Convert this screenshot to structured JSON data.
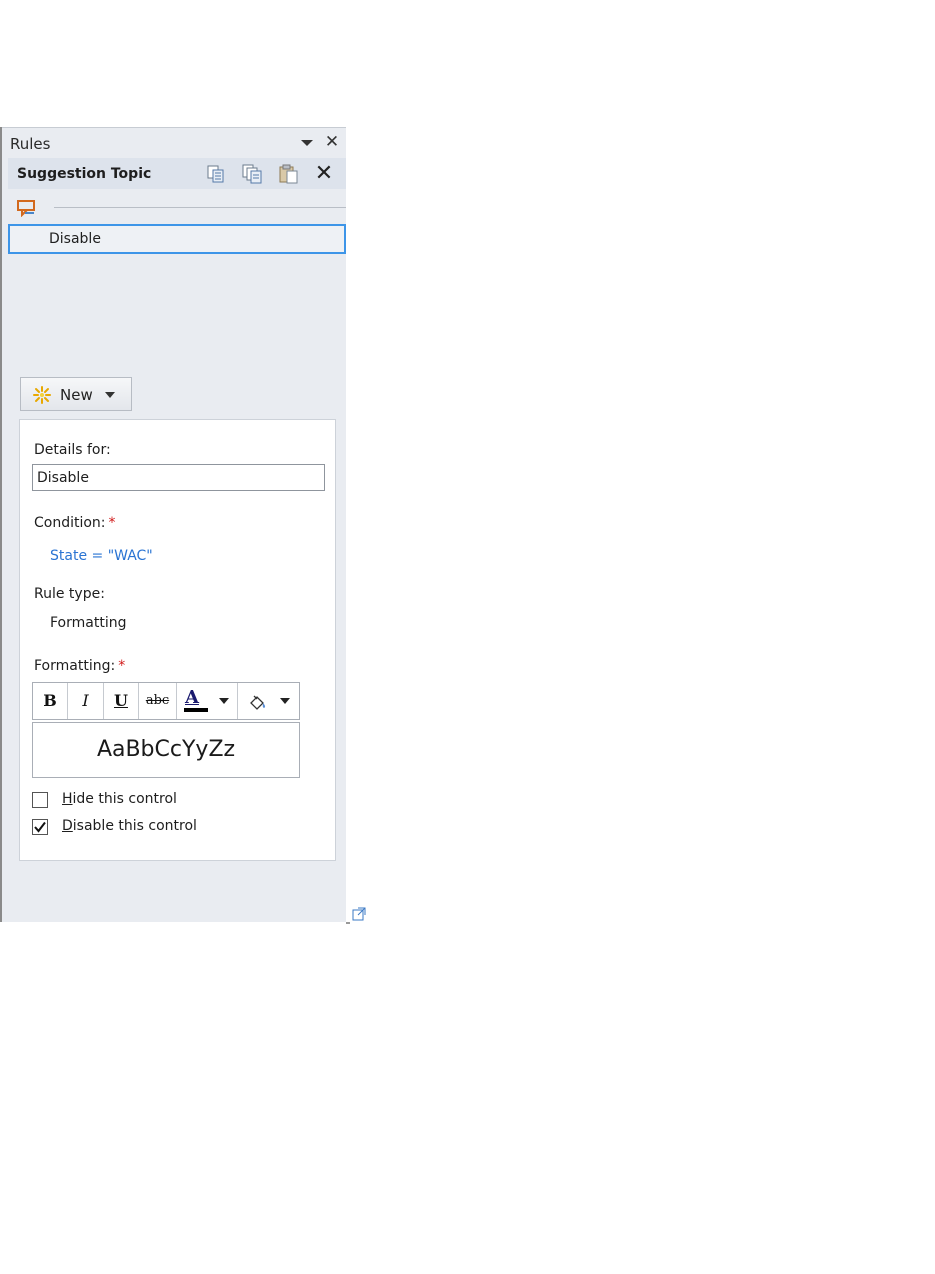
{
  "pane": {
    "title": "Rules",
    "menu_icon": "dropdown-triangle-icon",
    "close_glyph": "✕",
    "topic_title": "Suggestion Topic",
    "toolbar_icons": [
      "copy-rule-icon",
      "copy-all-rules-icon",
      "paste-rule-icon",
      "delete-rule-icon"
    ],
    "delete_glyph": "✕"
  },
  "rules_list": {
    "items": [
      {
        "label": "Disable",
        "selected": true
      }
    ]
  },
  "new_button": {
    "label": "New",
    "icon": "new-sparkle-icon"
  },
  "details": {
    "details_for_label": "Details for:",
    "name_value": "Disable",
    "condition_label": "Condition:",
    "required_marker": "*",
    "condition_value": "State = \"WAC\"",
    "rule_type_label": "Rule type:",
    "rule_type_value": "Formatting",
    "formatting_label": "Formatting:",
    "toolbar": {
      "bold": "B",
      "italic": "I",
      "underline": "U",
      "strikethrough": "abc",
      "font_color": "A"
    },
    "preview_text": "AaBbCcYyZz",
    "checkboxes": [
      {
        "accel": "H",
        "rest": "ide this control",
        "checked": false
      },
      {
        "accel": "D",
        "rest": "isable this control",
        "checked": true
      }
    ]
  },
  "colors": {
    "pane_bg": "#e9ecf1",
    "selection_border": "#3d95e8",
    "link": "#2a74d3",
    "required": "#d11a1a"
  }
}
